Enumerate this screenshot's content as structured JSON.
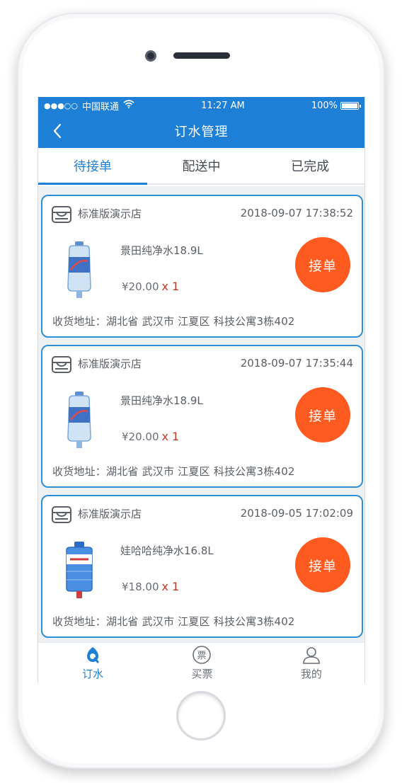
{
  "status_bar": {
    "signal": "●●●○○",
    "carrier": "中国联通",
    "time": "11:27 AM",
    "battery_text": "100%",
    "battery_level": 1.0
  },
  "nav": {
    "title": "订水管理"
  },
  "tabs": [
    {
      "label": "待接单",
      "active": true
    },
    {
      "label": "配送中",
      "active": false
    },
    {
      "label": "已完成",
      "active": false
    }
  ],
  "orders": [
    {
      "store": "标准版演示店",
      "time": "2018-09-07 17:38:52",
      "product": "景田纯净水18.9L",
      "price": "¥20.00",
      "qty": "x 1",
      "action": "接单",
      "address": "收货地址：湖北省 武汉市 江夏区 科技公寓3栋402"
    },
    {
      "store": "标准版演示店",
      "time": "2018-09-07 17:35:44",
      "product": "景田纯净水18.9L",
      "price": "¥20.00",
      "qty": "x 1",
      "action": "接单",
      "address": "收货地址：湖北省 武汉市 江夏区 科技公寓3栋402"
    },
    {
      "store": "标准版演示店",
      "time": "2018-09-05 17:02:09",
      "product": "娃哈哈纯净水16.8L",
      "price": "¥18.00",
      "qty": "x 1",
      "action": "接单",
      "address": "收货地址：湖北省 武汉市 江夏区 科技公寓3栋402"
    }
  ],
  "tabbar": [
    {
      "label": "订水",
      "icon": "water-drop-icon",
      "active": true
    },
    {
      "label": "买票",
      "icon": "ticket-icon",
      "active": false,
      "glyph": "票"
    },
    {
      "label": "我的",
      "icon": "user-icon",
      "active": false
    }
  ],
  "colors": {
    "primary": "#1e7fd6",
    "accent": "#ff5a1f",
    "quantity": "#c0392b"
  }
}
